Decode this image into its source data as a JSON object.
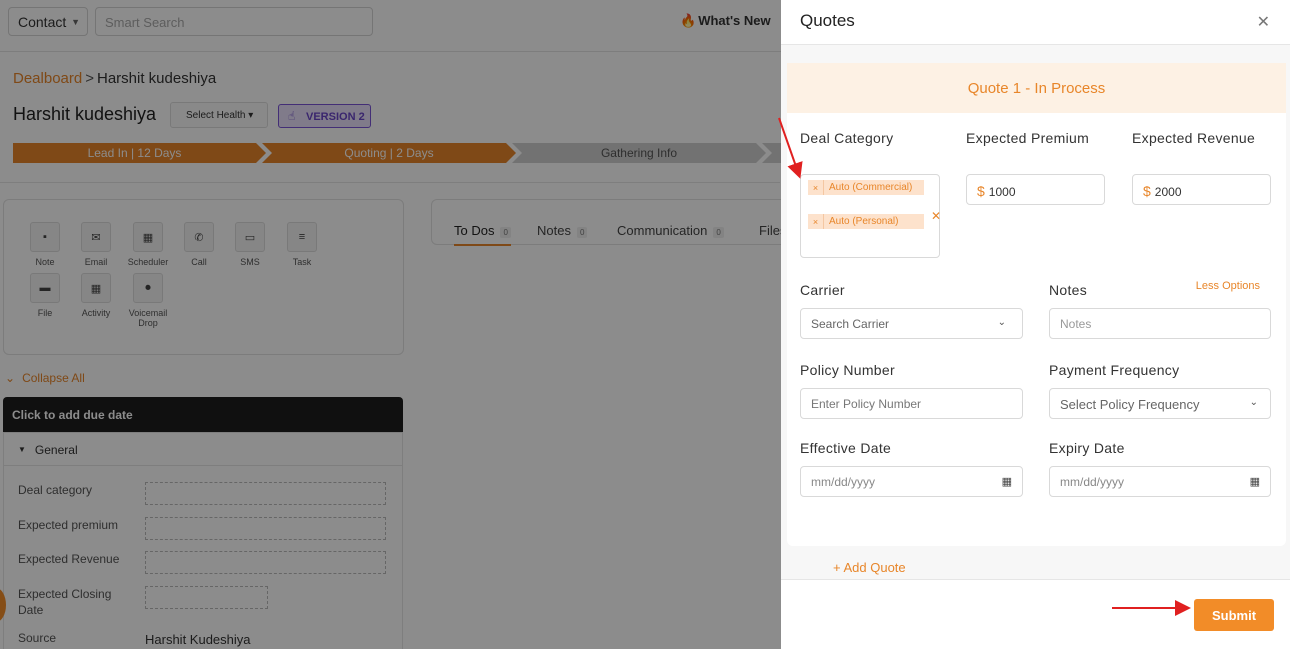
{
  "topbar": {
    "contact_select": "Contact",
    "search_placeholder": "Smart Search",
    "whats_new": "What's New"
  },
  "breadcrumb": {
    "root": "Dealboard",
    "separator": ">",
    "current": "Harshit kudeshiya"
  },
  "deal": {
    "title": "Harshit kudeshiya",
    "health_button": "Select Health",
    "version_badge": "VERSION 2"
  },
  "pipeline": [
    {
      "label": "Lead In | 12 Days",
      "active": true
    },
    {
      "label": "Quoting | 2 Days",
      "active": true
    },
    {
      "label": "Gathering Info",
      "active": false
    }
  ],
  "actions": [
    {
      "label": "Note",
      "icon": "note-icon"
    },
    {
      "label": "Email",
      "icon": "email-icon"
    },
    {
      "label": "Scheduler",
      "icon": "calendar-icon"
    },
    {
      "label": "Call",
      "icon": "phone-icon"
    },
    {
      "label": "SMS",
      "icon": "sms-icon"
    },
    {
      "label": "Task",
      "icon": "task-icon"
    },
    {
      "label": "File",
      "icon": "folder-icon"
    },
    {
      "label": "Activity",
      "icon": "calendar-icon"
    },
    {
      "label": "Voicemail Drop",
      "icon": "microphone-icon"
    }
  ],
  "collapse_all": "Collapse All",
  "todo_header": "Click to add due date",
  "general": {
    "section_label": "General",
    "fields": [
      {
        "label": "Deal category"
      },
      {
        "label": "Expected premium"
      },
      {
        "label": "Expected Revenue"
      },
      {
        "label": "Expected Closing Date"
      },
      {
        "label": "Source",
        "value": "Harshit Kudeshiya"
      }
    ]
  },
  "tabs": [
    {
      "label": "To Dos",
      "count": "0",
      "active": true
    },
    {
      "label": "Notes",
      "count": "0",
      "active": false
    },
    {
      "label": "Communication",
      "count": "0",
      "active": false
    },
    {
      "label": "Files",
      "count": "",
      "active": false
    }
  ],
  "drawer": {
    "title": "Quotes",
    "quote_banner": "Quote 1 - In Process",
    "deal_category_label": "Deal Category",
    "deal_category_tags": [
      "Auto (Commercial)",
      "Auto (Personal)"
    ],
    "expected_premium_label": "Expected Premium",
    "expected_premium_currency": "$",
    "expected_premium_value": "1000",
    "expected_revenue_label": "Expected Revenue",
    "expected_revenue_currency": "$",
    "expected_revenue_value": "2000",
    "less_options": "Less Options",
    "carrier_label": "Carrier",
    "carrier_placeholder": "Search Carrier",
    "notes_label": "Notes",
    "notes_placeholder": "Notes",
    "policy_number_label": "Policy Number",
    "policy_number_placeholder": "Enter Policy Number",
    "payment_frequency_label": "Payment Frequency",
    "payment_frequency_placeholder": "Select Policy Frequency",
    "effective_date_label": "Effective Date",
    "effective_date_placeholder": "mm/dd/yyyy",
    "expiry_date_label": "Expiry Date",
    "expiry_date_placeholder": "mm/dd/yyyy",
    "add_quote": "+ Add Quote",
    "submit": "Submit"
  },
  "colors": {
    "accent": "#e8862a",
    "submit": "#f28c28",
    "annotation_arrow": "#e02020",
    "version_purple": "#6a45c8"
  }
}
